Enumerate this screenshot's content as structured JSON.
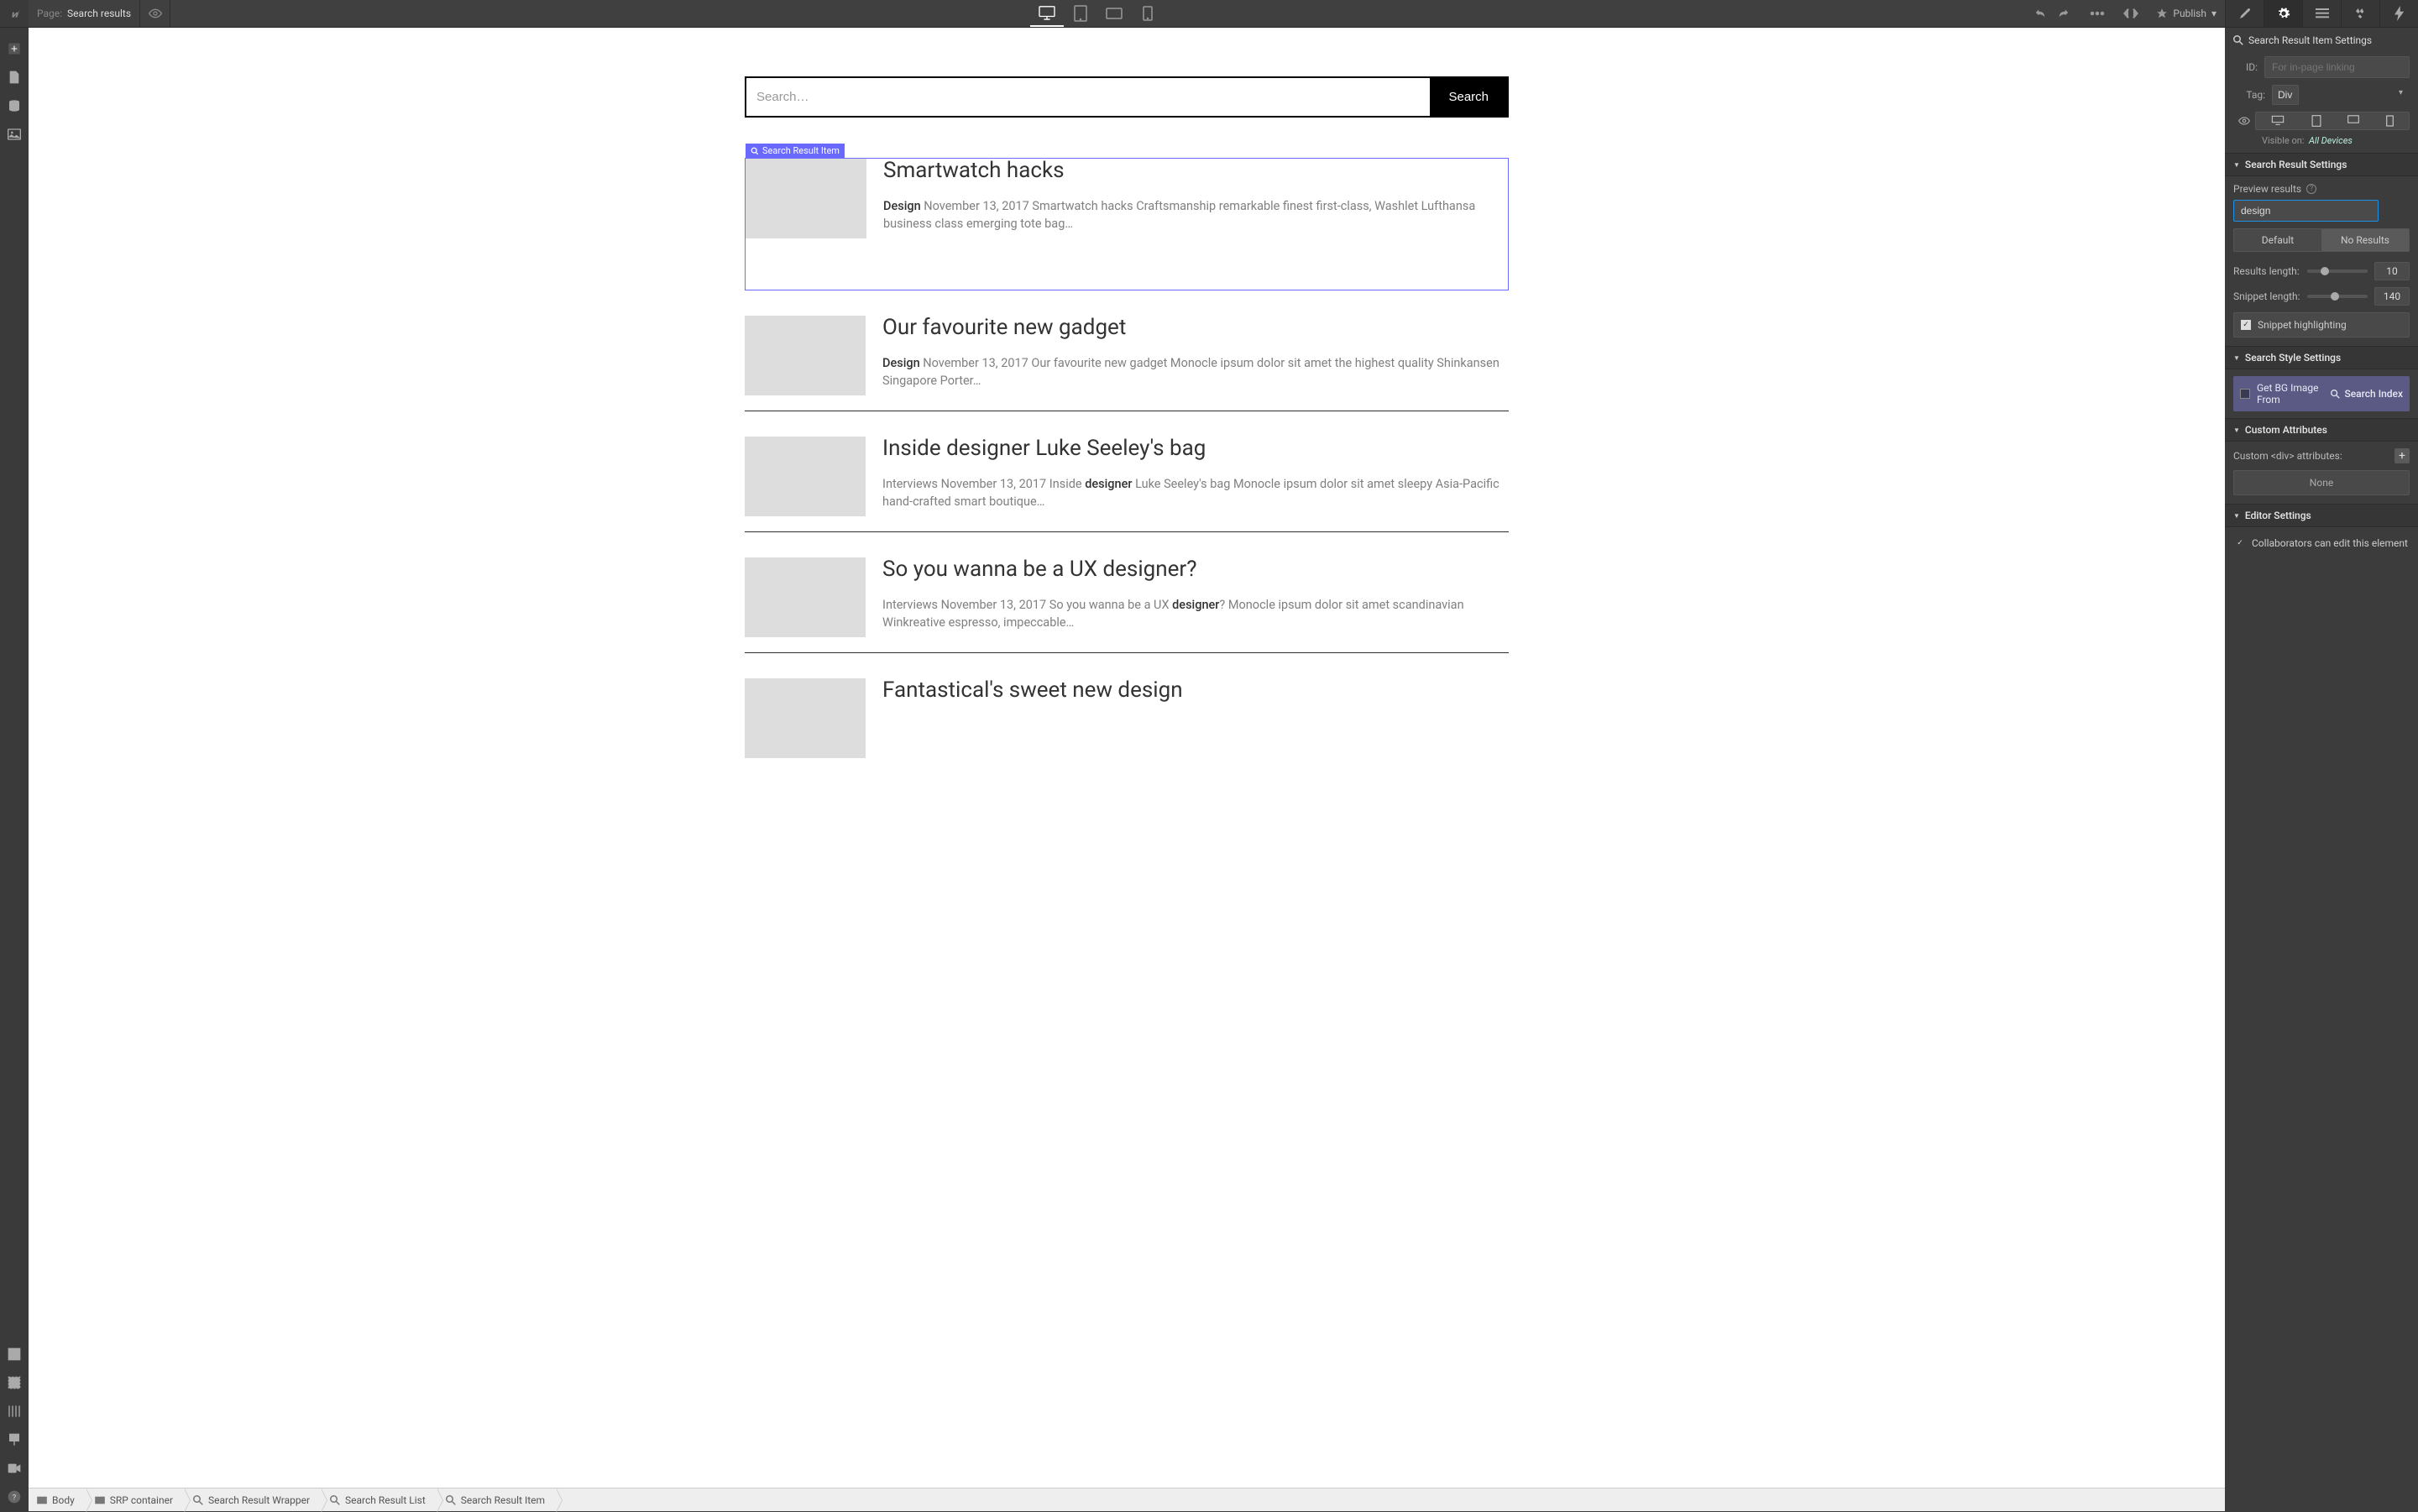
{
  "top": {
    "page_label": "Page:",
    "page_name": "Search results",
    "publish": "Publish"
  },
  "search": {
    "placeholder": "Search…",
    "button": "Search"
  },
  "sel_tag": "Search Result Item",
  "items": [
    {
      "title": "Smartwatch hacks",
      "cat": "Design",
      "rest": " November 13, 2017 Smartwatch hacks Craftsmanship remarkable finest first-class, Washlet Lufthansa business class emerging tote bag…"
    },
    {
      "title": "Our favourite new gadget",
      "cat": "Design",
      "rest": " November 13, 2017 Our favourite new gadget Monocle ipsum dolor sit amet the highest quality Shinkansen Singapore Porter…"
    },
    {
      "title": "Inside designer Luke Seeley's bag",
      "cat": "",
      "pre": "Interviews November 13, 2017 Inside ",
      "hi": "designer",
      "rest": " Luke Seeley's bag Monocle ipsum dolor sit amet sleepy Asia-Pacific hand-crafted smart boutique…"
    },
    {
      "title": "So you wanna be a UX designer?",
      "cat": "",
      "pre": "Interviews November 13, 2017 So you wanna be a UX ",
      "hi": "designer",
      "rest": "? Monocle ipsum dolor sit amet scandinavian Winkreative espresso, impeccable…"
    },
    {
      "title": "Fantastical's sweet new design",
      "cat": "",
      "pre": "",
      "hi": "",
      "rest": ""
    }
  ],
  "crumb": [
    "Body",
    "SRP container",
    "Search Result Wrapper",
    "Search Result List",
    "Search Result Item"
  ],
  "panel": {
    "header": "Search Result Item Settings",
    "id_label": "ID:",
    "id_placeholder": "For in-page linking",
    "tag_label": "Tag:",
    "tag_value": "Div",
    "visible_label": "Visible on:",
    "visible_value": "All Devices",
    "sect_results": "Search Result Settings",
    "preview_label": "Preview results",
    "preview_value": "design",
    "seg_default": "Default",
    "seg_noresults": "No Results",
    "results_len": "Results length:",
    "results_val": "10",
    "snippet_len": "Snippet length:",
    "snippet_val": "140",
    "snippet_hi": "Snippet highlighting",
    "sect_style": "Search Style Settings",
    "bg_label": "Get BG Image From",
    "bg_value": "Search Index",
    "sect_attrs": "Custom Attributes",
    "attrs_label": "Custom <div> attributes:",
    "attrs_none": "None",
    "sect_editor": "Editor Settings",
    "editor_chk": "Collaborators can edit this element"
  }
}
